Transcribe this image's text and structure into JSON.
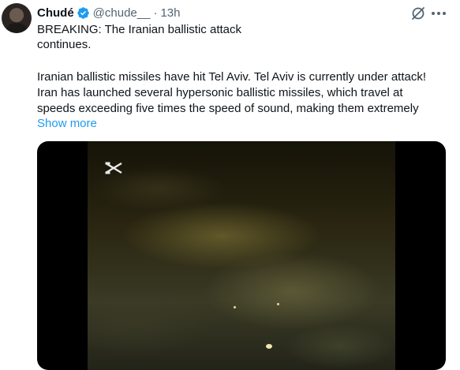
{
  "tweet": {
    "author_name": "Chudé",
    "handle": "@chude__",
    "separator": "·",
    "time": "13h",
    "lines": [
      "BREAKING: The Iranian ballistic attack",
      "continues."
    ],
    "paragraph_lines": [
      "Iranian ballistic missiles have hit Tel Aviv. Tel Aviv is currently under attack!",
      "Iran has launched several hypersonic ballistic missiles, which travel at",
      "speeds exceeding five times the speed of sound, making them extremely"
    ],
    "show_more": "Show more"
  },
  "icons": {
    "verified": "verified-badge-icon",
    "grok": "grok-icon",
    "more": "more-icon",
    "watermark": "capcut-icon"
  },
  "colors": {
    "accent": "#1d9bf0",
    "muted": "#536471",
    "text": "#0f1419"
  }
}
